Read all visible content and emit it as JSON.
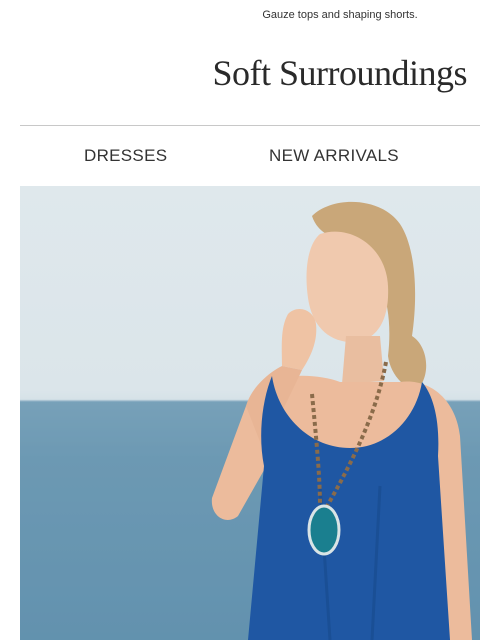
{
  "preheader": {
    "text": "Gauze tops and shaping shorts."
  },
  "brand": {
    "logo_text": "Soft Surroundings"
  },
  "nav": {
    "items": [
      {
        "label": "DRESSES"
      },
      {
        "label": "NEW ARRIVALS"
      }
    ]
  },
  "hero": {
    "subject": "woman-in-blue-dress",
    "colors": {
      "sky": "#dfe8ec",
      "sea": "#6e9ab4",
      "dress": "#1f57a3",
      "pendant": "#1a7f8f"
    }
  }
}
